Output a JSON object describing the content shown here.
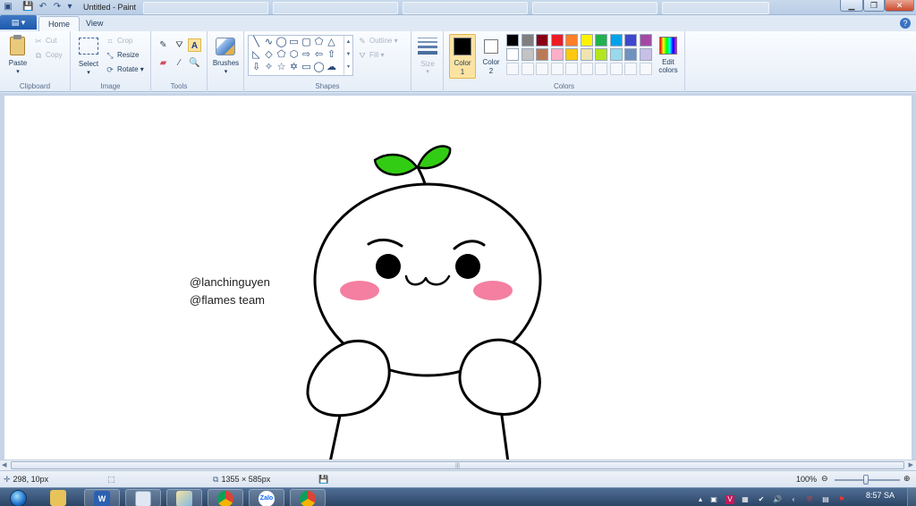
{
  "window": {
    "title": "Untitled - Paint",
    "minimize_icon": "minimize-icon",
    "maximize_icon": "restore-icon",
    "close_icon": "close-icon"
  },
  "quick_access": [
    "save-icon",
    "undo-icon",
    "redo-icon",
    "customize-dropdown-icon"
  ],
  "tabs": {
    "home": "Home",
    "view": "View"
  },
  "ribbon": {
    "clipboard": {
      "label": "Clipboard",
      "paste": "Paste",
      "cut": "Cut",
      "copy": "Copy"
    },
    "image": {
      "label": "Image",
      "select": "Select",
      "crop": "Crop",
      "resize": "Resize",
      "rotate": "Rotate"
    },
    "tools": {
      "label": "Tools"
    },
    "brushes": {
      "label": "Brushes"
    },
    "shapes": {
      "label": "Shapes",
      "outline": "Outline",
      "fill": "Fill"
    },
    "size": {
      "label": "Size"
    },
    "colors": {
      "label": "Colors",
      "color1_label": "Color",
      "color1_num": "1",
      "color2_label": "Color",
      "color2_num": "2",
      "color1": "#000000",
      "color2": "#ffffff",
      "edit": "Edit",
      "edit2": "colors",
      "palette_row1": [
        "#000000",
        "#7f7f7f",
        "#880015",
        "#ed1c24",
        "#ff7f27",
        "#fff200",
        "#22b14c",
        "#00a2e8",
        "#3f48cc",
        "#a349a4"
      ],
      "palette_row2": [
        "#ffffff",
        "#c3c3c3",
        "#b97a57",
        "#ffaec9",
        "#ffc90e",
        "#efe4b0",
        "#b5e61d",
        "#99d9ea",
        "#7092be",
        "#c8bfe7"
      ]
    }
  },
  "canvas": {
    "credit_line1": "@lanchinguyen",
    "credit_line2": "@flames team",
    "leaf_color": "#33cc14",
    "blush_color": "#f47fa0"
  },
  "status": {
    "cursor_pos": "298, 10px",
    "canvas_size": "1355 × 585px",
    "zoom": "100%"
  },
  "taskbar": {
    "clock_time": "8:57 SA",
    "apps": [
      "start-icon",
      "file-explorer-icon",
      "word-icon",
      "notepad-icon",
      "paint-icon",
      "chrome-icon",
      "zalo-icon",
      "chrome-icon"
    ],
    "word_letter": "W",
    "zalo_letter": "Zalo"
  }
}
